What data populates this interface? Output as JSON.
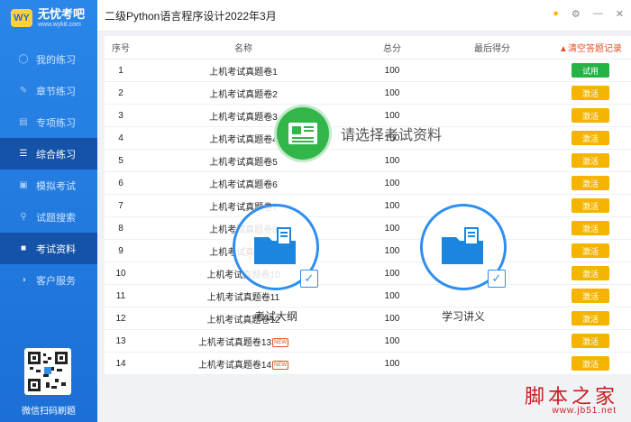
{
  "app": {
    "logo_badge": "WY",
    "logo_title": "无忧考吧",
    "logo_url": "www.wyk8.com",
    "window_title": "二级Python语言程序设计2022年3月"
  },
  "sidebar": {
    "items": [
      {
        "label": "我的练习",
        "icon": "user-icon"
      },
      {
        "label": "章节练习",
        "icon": "pencil-icon"
      },
      {
        "label": "专项练习",
        "icon": "document-icon"
      },
      {
        "label": "综合练习",
        "icon": "list-icon",
        "active": true
      },
      {
        "label": "模拟考试",
        "icon": "clipboard-icon"
      },
      {
        "label": "试题搜索",
        "icon": "search-icon"
      },
      {
        "label": "考试资料",
        "icon": "book-icon",
        "active": true
      },
      {
        "label": "客户服务",
        "icon": "headset-icon"
      }
    ],
    "qr_label": "微信扫码刷题"
  },
  "table": {
    "headers": {
      "idx": "序号",
      "name": "名称",
      "total": "总分",
      "last": "最后得分",
      "clear": "清空答题记录"
    },
    "rows": [
      {
        "idx": "1",
        "name": "上机考试真题卷1",
        "total": "100",
        "last": "",
        "action": "试用",
        "new": false
      },
      {
        "idx": "2",
        "name": "上机考试真题卷2",
        "total": "100",
        "last": "",
        "action": "激活",
        "new": false
      },
      {
        "idx": "3",
        "name": "上机考试真题卷3",
        "total": "100",
        "last": "",
        "action": "激活",
        "new": false
      },
      {
        "idx": "4",
        "name": "上机考试真题卷4",
        "total": "100",
        "last": "",
        "action": "激活",
        "new": false
      },
      {
        "idx": "5",
        "name": "上机考试真题卷5",
        "total": "100",
        "last": "",
        "action": "激活",
        "new": false
      },
      {
        "idx": "6",
        "name": "上机考试真题卷6",
        "total": "100",
        "last": "",
        "action": "激活",
        "new": false
      },
      {
        "idx": "7",
        "name": "上机考试真题卷7",
        "total": "100",
        "last": "",
        "action": "激活",
        "new": false
      },
      {
        "idx": "8",
        "name": "上机考试真题卷8",
        "total": "100",
        "last": "",
        "action": "激活",
        "new": false
      },
      {
        "idx": "9",
        "name": "上机考试真题卷9",
        "total": "100",
        "last": "",
        "action": "激活",
        "new": false
      },
      {
        "idx": "10",
        "name": "上机考试真题卷10",
        "total": "100",
        "last": "",
        "action": "激活",
        "new": false
      },
      {
        "idx": "11",
        "name": "上机考试真题卷11",
        "total": "100",
        "last": "",
        "action": "激活",
        "new": false
      },
      {
        "idx": "12",
        "name": "上机考试真题卷12",
        "total": "100",
        "last": "",
        "action": "激活",
        "new": false
      },
      {
        "idx": "13",
        "name": "上机考试真题卷13",
        "total": "100",
        "last": "",
        "action": "激活",
        "new": true
      },
      {
        "idx": "14",
        "name": "上机考试真题卷14",
        "total": "100",
        "last": "",
        "action": "激活",
        "new": true
      }
    ],
    "new_badge": "NEW"
  },
  "overlay": {
    "prompt": "请选择考试资料",
    "option_outline": "考试大纲",
    "option_notes": "学习讲义"
  },
  "watermark": {
    "main": "脚本之家",
    "url": "www.jb51.net"
  },
  "colors": {
    "sidebar_blue": "#1b6fd6",
    "try_green": "#26b346",
    "activate_yellow": "#f5b400",
    "clear_red": "#e5502b"
  }
}
